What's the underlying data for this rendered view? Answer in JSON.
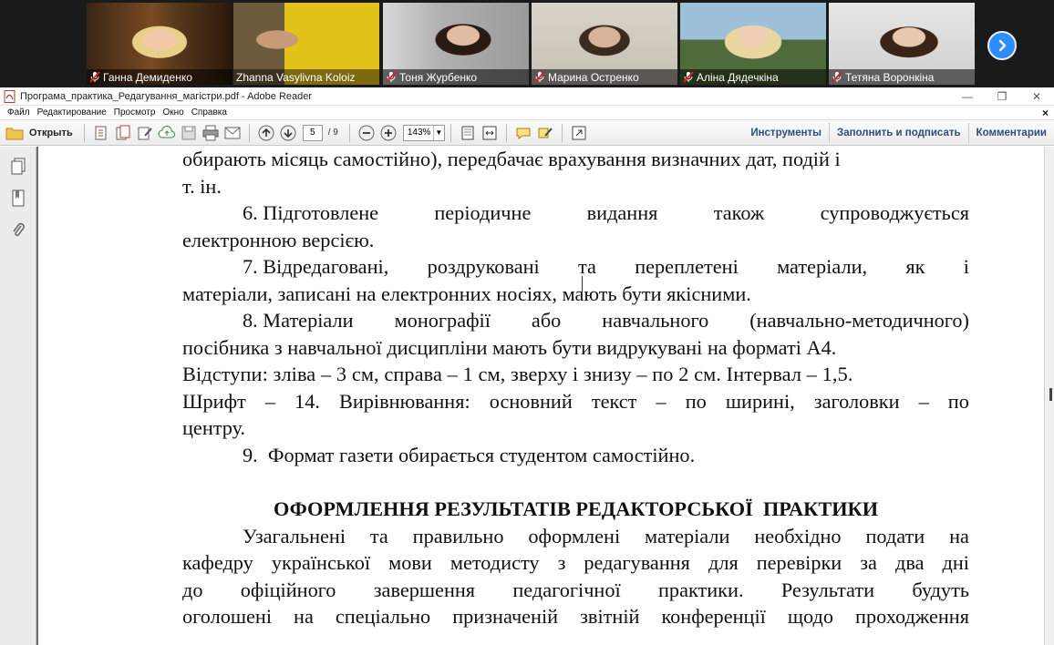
{
  "participants": [
    {
      "name": "Ганна Демиденко",
      "muted": true
    },
    {
      "name": "Zhanna Vasylivna Koloiz",
      "muted": false,
      "active": true
    },
    {
      "name": "Тоня Журбенко",
      "muted": true
    },
    {
      "name": "Марина Остренко",
      "muted": true
    },
    {
      "name": "Аліна Дядечкіна",
      "muted": true
    },
    {
      "name": "Тетяна Воронкіна",
      "muted": true
    }
  ],
  "window": {
    "title": "Програма_практика_Редагування_магістри.pdf - Adobe Reader",
    "menu": [
      "Файл",
      "Редактирование",
      "Просмотр",
      "Окно",
      "Справка"
    ]
  },
  "toolbar": {
    "open_label": "Открыть",
    "page_current": "5",
    "page_total": "/ 9",
    "zoom": "143%",
    "tools_label": "Инструменты",
    "sign_label": "Заполнить и подписать",
    "comments_label": "Комментарии"
  },
  "document": {
    "lines": [
      "обирають місяць самостійно), передбачає врахування визначних дат, подій і",
      "т. ін.",
      "6. Підготовлене періодичне видання також супроводжується",
      "електронною версією.",
      "7. Відредаговані, роздруковані та переплетені матеріали, як і",
      "матеріали, записані на електронних носіях, мають бути якісними.",
      "8. Матеріали монографії або навчального (навчально-методичного)",
      "посібника з навчальної дисципліни мають бути видрукувані на форматі А4.",
      "Відступи: зліва – 3 см, справа – 1 см, зверху і знизу – по 2 см. Інтервал – 1,5.",
      "Шрифт – 14. Вирівнювання: основний текст – по ширині, заголовки – по",
      "центру.",
      "9.  Формат газети обирається студентом самостійно.",
      "ОФОРМЛЕННЯ РЕЗУЛЬТАТІВ РЕДАКТОРСЬКОЇ  ПРАКТИКИ",
      "Узагальнені та правильно оформлені матеріали необхідно подати на",
      "кафедру української мови методисту з редагування для перевірки за два дні",
      "до офіційного завершення педагогічної практики. Результати будуть",
      "оголошені на спеціально призначеній звітній конференції щодо проходження"
    ]
  }
}
